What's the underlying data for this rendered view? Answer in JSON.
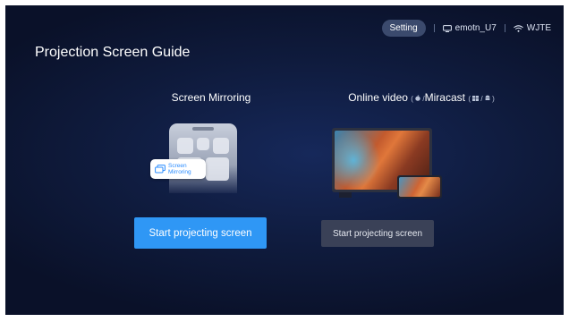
{
  "status_bar": {
    "setting_label": "Setting",
    "device_name": "emotn_U7",
    "device_icon": "monitor-icon",
    "wifi_name": "WJTE",
    "wifi_icon": "wifi-icon"
  },
  "page": {
    "title": "Projection Screen Guide"
  },
  "options": {
    "mirroring": {
      "title": "Screen Mirroring",
      "chip_line1": "Screen",
      "chip_line2": "Mirroring",
      "chip_icon": "screen-mirror-icon",
      "button_label": "Start projecting screen"
    },
    "online": {
      "title_part1": "Online video",
      "title_hint1": "( ",
      "title_hint1_icon": "apple-icon",
      "title_hint1_sep": " /",
      "title_part2": "Miracast",
      "title_hint2": "( ",
      "title_hint2_icon": "windows-icon",
      "title_hint2_sep": " / ",
      "title_hint2_icon2": "android-icon",
      "title_hint2_end": " )",
      "button_label": "Start projecting screen"
    }
  },
  "colors": {
    "primary_button": "#2f97f5",
    "secondary_button": "#3a4157",
    "background": "#0f1b3d"
  }
}
